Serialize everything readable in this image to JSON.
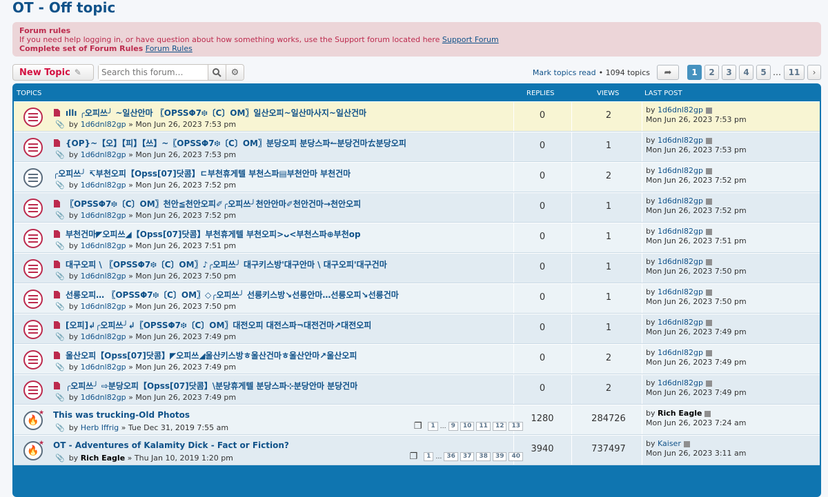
{
  "page": {
    "title": "OT - Off topic"
  },
  "rules": {
    "heading": "Forum rules",
    "text": "If you need help logging in, or have question about how something works, use the Support forum located here ",
    "support_link": "Support Forum",
    "complete_label": "Complete set of Forum Rules",
    "rules_link": "Forum Rules"
  },
  "action_bar": {
    "new_topic": "New Topic",
    "search_placeholder": "Search this forum…",
    "mark_read": "Mark topics read",
    "topic_count": "• 1094 topics",
    "pages": [
      "1",
      "2",
      "3",
      "4",
      "5"
    ],
    "ellipsis": "…",
    "last_page": "11"
  },
  "table": {
    "headers": {
      "topics": "TOPICS",
      "replies": "REPLIES",
      "views": "VIEWS",
      "last_post": "LAST POST"
    },
    "rows": [
      {
        "title": "ıllı ╭오피쓰╯ ~일산안마 〖OPSSΦ7፨〔C〕OM〗일산오피~일산마사지~일산건마",
        "author": "1d6dnl82gp",
        "date": "» Mon Jun 26, 2023 7:53 pm",
        "replies": "0",
        "views": "2",
        "lp_author": "1d6dnl82gp",
        "lp_date": "Mon Jun 26, 2023 7:53 pm"
      },
      {
        "title": "{OP}~【오】【피】【쓰】~〖OPSSΦ7፨〔C〕OM〗분당오피 분당스파↼분당건마ㄊ분당오피",
        "author": "1d6dnl82gp",
        "date": "» Mon Jun 26, 2023 7:53 pm",
        "replies": "0",
        "views": "1",
        "lp_author": "1d6dnl82gp",
        "lp_date": "Mon Jun 26, 2023 7:53 pm"
      },
      {
        "title": "╭오피쓰╯ ↸부천오피【Opss[07]닷콤】ㄷ부천휴게텔 부천스파▤부천안마 부천건마",
        "author": "1d6dnl82gp",
        "date": "» Mon Jun 26, 2023 7:52 pm",
        "replies": "0",
        "views": "2",
        "lp_author": "1d6dnl82gp",
        "lp_date": "Mon Jun 26, 2023 7:52 pm"
      },
      {
        "title": "〖OPSSΦ7፨〔C〕OM〗천안≦천안오피✐╭오피쓰╯천안안마✐천안건마→천안오피",
        "author": "1d6dnl82gp",
        "date": "» Mon Jun 26, 2023 7:52 pm",
        "replies": "0",
        "views": "1",
        "lp_author": "1d6dnl82gp",
        "lp_date": "Mon Jun 26, 2023 7:52 pm"
      },
      {
        "title": "부천건마◤오피쓰◢【Opss[07]닷콤】부천휴게텔 부천오피>ᴗ<부천스파⊕부천op",
        "author": "1d6dnl82gp",
        "date": "» Mon Jun 26, 2023 7:51 pm",
        "replies": "0",
        "views": "1",
        "lp_author": "1d6dnl82gp",
        "lp_date": "Mon Jun 26, 2023 7:51 pm"
      },
      {
        "title": "대구오피 \\ 〖OPSSΦ7፨〔C〕OM〗♪╭오피쓰╯ 대구키스방'대구안마 \\ 대구오피'대구건마",
        "author": "1d6dnl82gp",
        "date": "» Mon Jun 26, 2023 7:50 pm",
        "replies": "0",
        "views": "1",
        "lp_author": "1d6dnl82gp",
        "lp_date": "Mon Jun 26, 2023 7:50 pm"
      },
      {
        "title": "선릉오피… 〖OPSSΦ7፨〔C〕OM〗◇╭오피쓰╯ 선릉키스방↘선릉안마…선릉오피↘선릉건마",
        "author": "1d6dnl82gp",
        "date": "» Mon Jun 26, 2023 7:50 pm",
        "replies": "0",
        "views": "1",
        "lp_author": "1d6dnl82gp",
        "lp_date": "Mon Jun 26, 2023 7:50 pm"
      },
      {
        "title": "[오피]↲╭오피쓰╯↲〖OPSSΦ7፨〔C〕OM〗대전오피 대전스파¬대전건마↗대전오피",
        "author": "1d6dnl82gp",
        "date": "» Mon Jun 26, 2023 7:49 pm",
        "replies": "0",
        "views": "1",
        "lp_author": "1d6dnl82gp",
        "lp_date": "Mon Jun 26, 2023 7:49 pm"
      },
      {
        "title": "울산오피【Opss[07]닷콤】◤오피쓰◢울산키스방ㅎ울산건마ㅎ울산안마↗울산오피",
        "author": "1d6dnl82gp",
        "date": "» Mon Jun 26, 2023 7:49 pm",
        "replies": "0",
        "views": "2",
        "lp_author": "1d6dnl82gp",
        "lp_date": "Mon Jun 26, 2023 7:49 pm"
      },
      {
        "title": "╭오피쓰╯ ⇨분당오피【Opss[07]닷콤】\\분당휴게텔 분당스파⊹분당안마 분당건마",
        "author": "1d6dnl82gp",
        "date": "» Mon Jun 26, 2023 7:49 pm",
        "replies": "0",
        "views": "2",
        "lp_author": "1d6dnl82gp",
        "lp_date": "Mon Jun 26, 2023 7:49 pm"
      },
      {
        "title": "This was trucking-Old Photos",
        "author": "Herb Iffrig",
        "date": "» Tue Dec 31, 2019 7:55 am",
        "replies": "1280",
        "views": "284726",
        "lp_author": "Rich Eagle",
        "lp_date": "Mon Jun 26, 2023 7:24 am",
        "pages": [
          "1",
          "…",
          "9",
          "10",
          "11",
          "12",
          "13"
        ]
      },
      {
        "title": "OT - Adventures of Kalamity Dick - Fact or Fiction?",
        "author": "Rich Eagle",
        "date": "» Thu Jan 10, 2019 1:20 pm",
        "replies": "3940",
        "views": "737497",
        "lp_author": "Kaiser",
        "lp_date": "Mon Jun 26, 2023 3:11 am",
        "pages": [
          "1",
          "…",
          "36",
          "37",
          "38",
          "39",
          "40"
        ]
      }
    ],
    "by": "by"
  },
  "colors": {
    "link": "#105289",
    "accent": "#bc2a4d",
    "header": "#0f75b0",
    "highlight": "#f8f5d3"
  }
}
